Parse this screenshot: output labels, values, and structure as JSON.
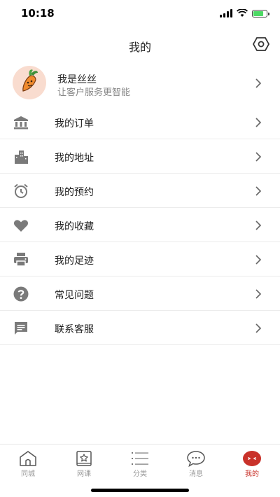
{
  "status": {
    "time": "10:18"
  },
  "header": {
    "title": "我的"
  },
  "profile": {
    "name": "我是丝丝",
    "subtitle": "让客户服务更智能"
  },
  "menu": [
    {
      "label": "我的订单",
      "icon": "bank-icon"
    },
    {
      "label": "我的地址",
      "icon": "buildings-icon"
    },
    {
      "label": "我的预约",
      "icon": "alarm-clock-icon"
    },
    {
      "label": "我的收藏",
      "icon": "heart-icon"
    },
    {
      "label": "我的足迹",
      "icon": "printer-icon"
    },
    {
      "label": "常见问题",
      "icon": "help-icon"
    },
    {
      "label": "联系客服",
      "icon": "chat-message-icon"
    }
  ],
  "tabs": [
    {
      "label": "同城",
      "icon": "home-icon"
    },
    {
      "label": "网课",
      "icon": "star-book-icon"
    },
    {
      "label": "分类",
      "icon": "list-icon"
    },
    {
      "label": "消息",
      "icon": "chat-bubble-icon"
    },
    {
      "label": "我的",
      "icon": "profile-face-icon",
      "active": true
    }
  ],
  "colors": {
    "accent": "#c9322a",
    "icon_gray": "#7a7a7a",
    "tab_gray": "#9a9a9a"
  }
}
